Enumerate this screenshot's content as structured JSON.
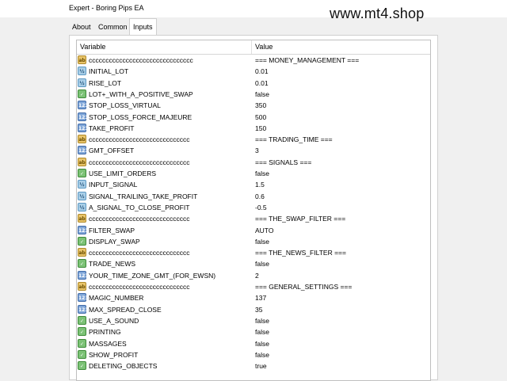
{
  "window": {
    "title": "Expert - Boring Pips EA"
  },
  "watermark": "www.mt4.shop",
  "tabs": [
    {
      "label": "About"
    },
    {
      "label": "Common"
    },
    {
      "label": "Inputs",
      "active": true
    }
  ],
  "table": {
    "headers": {
      "variable": "Variable",
      "value": "Value"
    },
    "rows": [
      {
        "type": "ab",
        "icon": "string-icon",
        "variable": "ccccccccccccccccccccccccccccccc",
        "value": "=== MONEY_MANAGEMENT ==="
      },
      {
        "type": "dbl",
        "icon": "double-icon",
        "variable": "INITIAL_LOT",
        "value": "0.01"
      },
      {
        "type": "dbl",
        "icon": "double-icon",
        "variable": "RISE_LOT",
        "value": "0.01"
      },
      {
        "type": "bool",
        "icon": "bool-icon",
        "variable": "LOT+_WITH_A_POSITIVE_SWAP",
        "value": "false"
      },
      {
        "type": "num",
        "icon": "int-icon",
        "variable": "STOP_LOSS_VIRTUAL",
        "value": "350"
      },
      {
        "type": "num",
        "icon": "int-icon",
        "variable": "STOP_LOSS_FORCE_MAJEURE",
        "value": "500"
      },
      {
        "type": "num",
        "icon": "int-icon",
        "variable": "TAKE_PROFIT",
        "value": "150"
      },
      {
        "type": "ab",
        "icon": "string-icon",
        "variable": "cccccccccccccccccccccccccccccc",
        "value": "=== TRADING_TIME ==="
      },
      {
        "type": "num",
        "icon": "int-icon",
        "variable": "GMT_OFFSET",
        "value": "3"
      },
      {
        "type": "ab",
        "icon": "string-icon",
        "variable": "cccccccccccccccccccccccccccccc",
        "value": "=== SIGNALS ==="
      },
      {
        "type": "bool",
        "icon": "bool-icon",
        "variable": "USE_LIMIT_ORDERS",
        "value": "false"
      },
      {
        "type": "dbl",
        "icon": "double-icon",
        "variable": "INPUT_SIGNAL",
        "value": "1.5"
      },
      {
        "type": "dbl",
        "icon": "double-icon",
        "variable": "SIGNAL_TRAILING_TAKE_PROFIT",
        "value": "0.6"
      },
      {
        "type": "dbl",
        "icon": "double-icon",
        "variable": "A_SIGNAL_TO_CLOSE_PROFIT",
        "value": "-0.5"
      },
      {
        "type": "ab",
        "icon": "string-icon",
        "variable": "cccccccccccccccccccccccccccccc",
        "value": "=== THE_SWAP_FILTER ==="
      },
      {
        "type": "num",
        "icon": "int-icon",
        "variable": "FILTER_SWAP",
        "value": "AUTO"
      },
      {
        "type": "bool",
        "icon": "bool-icon",
        "variable": "DISPLAY_SWAP",
        "value": "false"
      },
      {
        "type": "ab",
        "icon": "string-icon",
        "variable": "cccccccccccccccccccccccccccccc",
        "value": "=== THE_NEWS_FILTER ==="
      },
      {
        "type": "bool",
        "icon": "bool-icon",
        "variable": "TRADE_NEWS",
        "value": "false"
      },
      {
        "type": "num",
        "icon": "int-icon",
        "variable": "YOUR_TIME_ZONE_GMT_(FOR_EWSN)",
        "value": "2"
      },
      {
        "type": "ab",
        "icon": "string-icon",
        "variable": "cccccccccccccccccccccccccccccc",
        "value": "=== GENERAL_SETTINGS ==="
      },
      {
        "type": "num",
        "icon": "int-icon",
        "variable": "MAGIC_NUMBER",
        "value": "137"
      },
      {
        "type": "num",
        "icon": "int-icon",
        "variable": "MAX_SPREAD_CLOSE",
        "value": "35"
      },
      {
        "type": "bool",
        "icon": "bool-icon",
        "variable": "USE_A_SOUND",
        "value": "false"
      },
      {
        "type": "bool",
        "icon": "bool-icon",
        "variable": "PRINTING",
        "value": "false"
      },
      {
        "type": "bool",
        "icon": "bool-icon",
        "variable": "MASSAGES",
        "value": "false"
      },
      {
        "type": "bool",
        "icon": "bool-icon",
        "variable": "SHOW_PROFIT",
        "value": "false"
      },
      {
        "type": "bool",
        "icon": "bool-icon",
        "variable": "DELETING_OBJECTS",
        "value": "true"
      }
    ]
  }
}
